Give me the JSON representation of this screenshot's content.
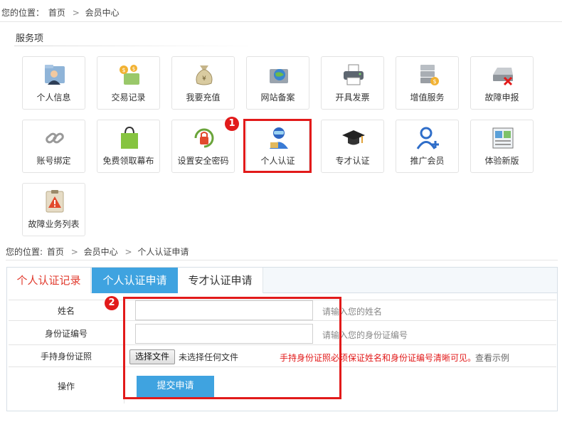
{
  "breadcrumb_top": {
    "prefix": "您的位置：",
    "home": "首页",
    "sep": ">",
    "current": "会员中心"
  },
  "services": {
    "title": "服务项",
    "items": [
      {
        "label": "个人信息",
        "icon": "user-folder-icon"
      },
      {
        "label": "交易记录",
        "icon": "money-transactions-icon"
      },
      {
        "label": "我要充值",
        "icon": "money-bag-icon"
      },
      {
        "label": "网站备案",
        "icon": "globe-record-icon"
      },
      {
        "label": "开具发票",
        "icon": "printer-icon"
      },
      {
        "label": "增值服务",
        "icon": "server-coin-icon"
      },
      {
        "label": "故障申报",
        "icon": "drive-error-icon"
      },
      {
        "label": "账号绑定",
        "icon": "chain-link-icon"
      },
      {
        "label": "免费领取幕布",
        "icon": "shopping-bag-icon"
      },
      {
        "label": "设置安全密码",
        "icon": "security-lock-icon"
      },
      {
        "label": "个人认证",
        "icon": "person-verify-icon"
      },
      {
        "label": "专才认证",
        "icon": "graduation-cap-icon"
      },
      {
        "label": "推广会员",
        "icon": "add-user-icon"
      },
      {
        "label": "体验新版",
        "icon": "new-version-window-icon"
      },
      {
        "label": "故障业务列表",
        "icon": "warning-clipboard-icon"
      }
    ]
  },
  "annotations": {
    "badge1": "1",
    "badge2": "2"
  },
  "breadcrumb_second": {
    "prefix": "您的位置:",
    "home": "首页",
    "sep": ">",
    "mid": "会员中心",
    "sep2": ">",
    "current": "个人认证申请"
  },
  "tabs": [
    {
      "label": "个人认证记录"
    },
    {
      "label": "个人认证申请"
    },
    {
      "label": "专才认证申请"
    }
  ],
  "form": {
    "name_label": "姓名",
    "name_value": "",
    "name_hint": "请输入您的姓名",
    "id_label": "身份证编号",
    "id_value": "",
    "id_hint": "请输入您的身份证编号",
    "photo_label": "手持身份证照",
    "file_button": "选择文件",
    "file_status": "未选择任何文件",
    "photo_warning": "手持身份证照必须保证姓名和身份证编号清晰可见。",
    "example_link": "查看示例",
    "action_label": "操作",
    "submit_label": "提交申请"
  },
  "colors": {
    "accent": "#3fa3e0",
    "highlight": "#e21a1a",
    "tab_red": "#e13a2d"
  }
}
